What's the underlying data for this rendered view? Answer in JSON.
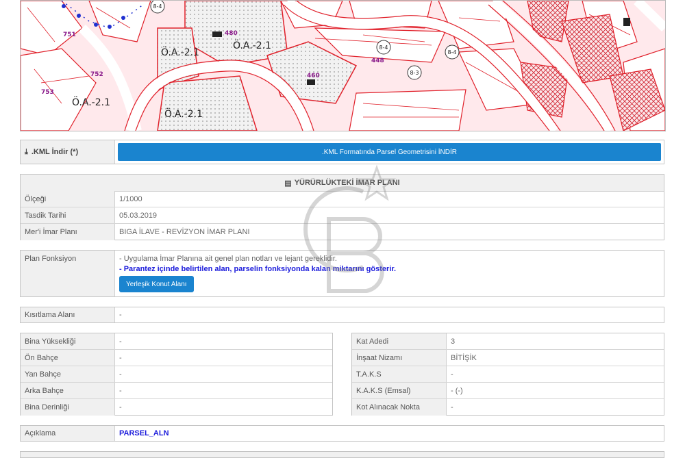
{
  "map": {
    "zone_labels": [
      "Ö.A.-2.1",
      "Ö.A.-2.1",
      "Ö.A.-2.1",
      "Ö.A.-2.1"
    ],
    "parcel_numbers": [
      "480",
      "460",
      "448",
      "751",
      "752",
      "753"
    ],
    "road_labels": [
      "8-4",
      "8-4",
      "8-3",
      "8-4"
    ]
  },
  "kml": {
    "label": ".KML İndir (*)",
    "button": ".KML Formatında Parsel Geometrisini İNDİR"
  },
  "plan": {
    "header": "YÜRÜRLÜKTEKİ İMAR PLANI",
    "rows": [
      {
        "label": "Ölçeği",
        "value": "1/1000"
      },
      {
        "label": "Tasdik Tarihi",
        "value": "05.03.2019"
      },
      {
        "label": "Mer'i İmar Planı",
        "value": "BIGA İLAVE - REVİZYON İMAR PLANI"
      }
    ]
  },
  "function": {
    "label": "Plan Fonksiyon",
    "note1": "- Uygulama İmar Planına ait genel plan notları ve lejant gereklidir.",
    "note2": "- Parantez içinde belirtilen alan, parselin fonksiyonda kalan miktarını gösterir.",
    "button": "Yerleşik Konut Alanı"
  },
  "restriction": {
    "label": "Kısıtlama Alanı",
    "value": "-"
  },
  "left_table": [
    {
      "label": "Bina Yüksekliği",
      "value": "-"
    },
    {
      "label": "Ön Bahçe",
      "value": "-"
    },
    {
      "label": "Yan Bahçe",
      "value": "-"
    },
    {
      "label": "Arka Bahçe",
      "value": "-"
    },
    {
      "label": "Bina Derinliği",
      "value": "-"
    }
  ],
  "right_table": [
    {
      "label": "Kat Adedi",
      "value": "3"
    },
    {
      "label": "İnşaat Nizamı",
      "value": "BİTİŞİK"
    },
    {
      "label": "T.A.K.S",
      "value": "-"
    },
    {
      "label": "K.A.K.S (Emsal)",
      "value": "- (-)"
    },
    {
      "label": "Kot Alınacak Nokta",
      "value": "-"
    }
  ],
  "note": {
    "label": "Açıklama",
    "value": "PARSEL_ALN"
  },
  "colors": {
    "accent": "#1a84cf",
    "parcel_line": "#e0202a",
    "note_text": "#1a1adb"
  },
  "icons": {
    "download": "download-icon",
    "document": "document-icon",
    "plan": "map-pin-icon"
  }
}
